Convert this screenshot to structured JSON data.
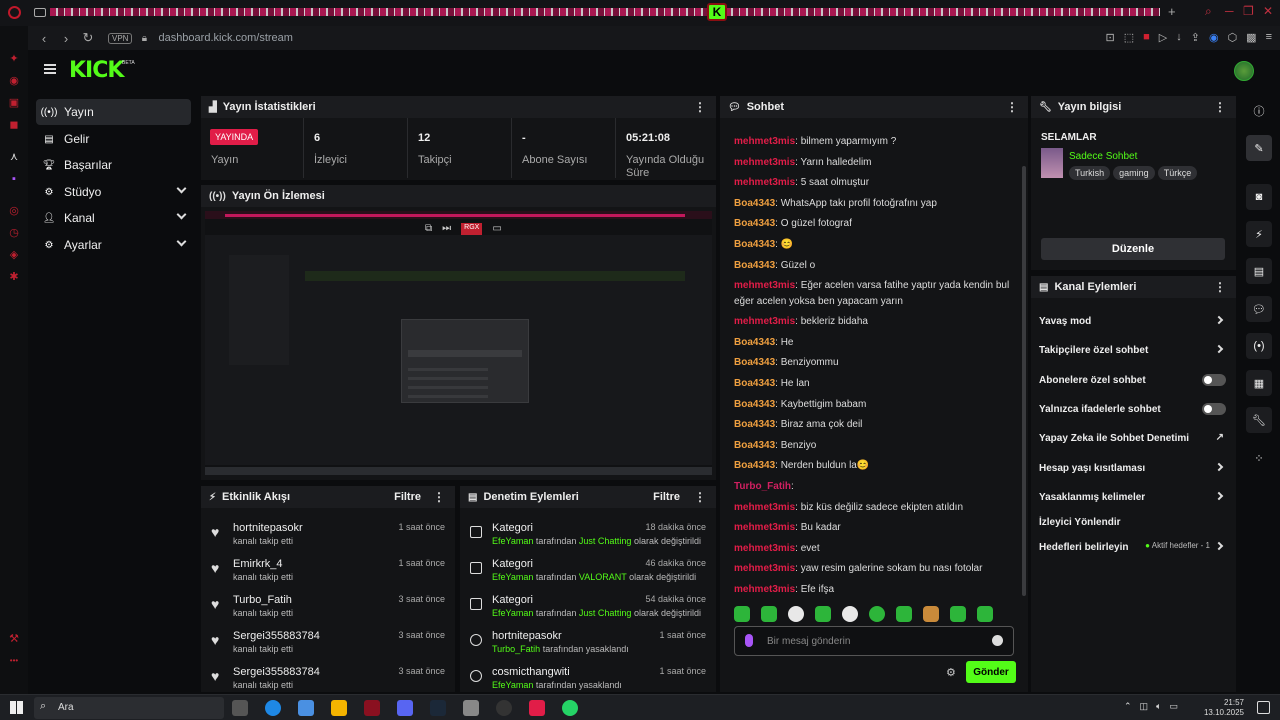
{
  "browser": {
    "url": "dashboard.kick.com/stream",
    "vpn_label": "VPN"
  },
  "header": {
    "logo": "KICK",
    "beta": "BETA"
  },
  "sidebar": {
    "items": [
      {
        "label": "Yayın",
        "icon": "broadcast-icon"
      },
      {
        "label": "Gelir",
        "icon": "wallet-icon"
      },
      {
        "label": "Başarılar",
        "icon": "trophy-icon"
      },
      {
        "label": "Stüdyo",
        "icon": "gear-icon"
      },
      {
        "label": "Kanal",
        "icon": "user-icon"
      },
      {
        "label": "Ayarlar",
        "icon": "gear-icon"
      }
    ]
  },
  "stats": {
    "title": "Yayın İstatistikleri",
    "live_badge": "YAYINDA",
    "live_label": "Yayın",
    "viewers_value": "6",
    "viewers_label": "İzleyici",
    "followers_value": "12",
    "followers_label": "Takipçi",
    "subs_value": "-",
    "subs_label": "Abone Sayısı",
    "uptime_value": "05:21:08",
    "uptime_label": "Yayında Olduğu Süre"
  },
  "preview": {
    "title": "Yayın Ön İzlemesi"
  },
  "activity": {
    "title": "Etkinlik Akışı",
    "filter": "Filtre",
    "items": [
      {
        "name": "hortnitepasokr",
        "sub": "kanalı takip etti",
        "time": "1 saat önce"
      },
      {
        "name": "Emirkrk_4",
        "sub": "kanalı takip etti",
        "time": "1 saat önce"
      },
      {
        "name": "Turbo_Fatih",
        "sub": "kanalı takip etti",
        "time": "3 saat önce"
      },
      {
        "name": "Sergei355883784",
        "sub": "kanalı takip etti",
        "time": "3 saat önce"
      },
      {
        "name": "Sergei355883784",
        "sub": "kanalı takip etti",
        "time": "3 saat önce"
      }
    ]
  },
  "moderation": {
    "title": "Denetim Eylemleri",
    "filter": "Filtre",
    "items": [
      {
        "title": "Kategori",
        "time": "18 dakika önce",
        "actor": "EfeYaman",
        "mid": " tarafından ",
        "target": "Just Chatting",
        "tail": " olarak değiştirildi"
      },
      {
        "title": "Kategori",
        "time": "46 dakika önce",
        "actor": "EfeYaman",
        "mid": " tarafından ",
        "target": "VALORANT",
        "tail": " olarak değiştirildi"
      },
      {
        "title": "Kategori",
        "time": "54 dakika önce",
        "actor": "EfeYaman",
        "mid": " tarafından ",
        "target": "Just Chatting",
        "tail": " olarak değiştirildi"
      },
      {
        "title": "hortnitepasokr",
        "time": "1 saat önce",
        "actor": "Turbo_Fatih",
        "mid": " tarafından yasaklandı",
        "target": "",
        "tail": ""
      },
      {
        "title": "cosmicthangwiti",
        "time": "1 saat önce",
        "actor": "EfeYaman",
        "mid": " tarafından yasaklandı",
        "target": "",
        "tail": ""
      }
    ]
  },
  "chat": {
    "title": "Sohbet",
    "messages": [
      {
        "user": "mehmet3mis",
        "text": "bilmem yaparmıyım ?",
        "cls": "u-mehmet"
      },
      {
        "user": "mehmet3mis",
        "text": "Yarın halledelim",
        "cls": "u-mehmet"
      },
      {
        "user": "mehmet3mis",
        "text": "5 saat olmuştur",
        "cls": "u-mehmet"
      },
      {
        "user": "Boa4343",
        "text": "WhatsApp takı profil fotoğrafını yap",
        "cls": "u-boa"
      },
      {
        "user": "Boa4343",
        "text": "O güzel fotograf",
        "cls": "u-boa"
      },
      {
        "user": "Boa4343",
        "text": "😊",
        "cls": "u-boa"
      },
      {
        "user": "Boa4343",
        "text": "Güzel o",
        "cls": "u-boa"
      },
      {
        "user": "mehmet3mis",
        "text": "Eğer acelen varsa fatihe yaptır yada kendin bul eğer acelen yoksa ben yapacam yarın",
        "cls": "u-mehmet"
      },
      {
        "user": "mehmet3mis",
        "text": "bekleriz bidaha",
        "cls": "u-mehmet"
      },
      {
        "user": "Boa4343",
        "text": "He",
        "cls": "u-boa"
      },
      {
        "user": "Boa4343",
        "text": "Benziyommu",
        "cls": "u-boa"
      },
      {
        "user": "Boa4343",
        "text": "He lan",
        "cls": "u-boa"
      },
      {
        "user": "Boa4343",
        "text": "Kaybettigim babam",
        "cls": "u-boa"
      },
      {
        "user": "Boa4343",
        "text": "Biraz ama çok deil",
        "cls": "u-boa"
      },
      {
        "user": "Boa4343",
        "text": "Benziyo",
        "cls": "u-boa"
      },
      {
        "user": "Boa4343",
        "text": "Nerden buldun la😊",
        "cls": "u-boa"
      },
      {
        "user": "Turbo_Fatih",
        "text": "",
        "cls": "u-turbo"
      },
      {
        "user": "mehmet3mis",
        "text": "biz küs değiliz sadece ekipten atıldın",
        "cls": "u-mehmet"
      },
      {
        "user": "mehmet3mis",
        "text": "Bu kadar",
        "cls": "u-mehmet"
      },
      {
        "user": "mehmet3mis",
        "text": "evet",
        "cls": "u-mehmet"
      },
      {
        "user": "mehmet3mis",
        "text": "yaw resim galerine sokam bu nası fotolar",
        "cls": "u-mehmet"
      },
      {
        "user": "mehmet3mis",
        "text": "Efe ifşa",
        "cls": "u-mehmet"
      }
    ],
    "input_placeholder": "Bir mesaj gönderin",
    "send_label": "Gönder"
  },
  "stream_info": {
    "title": "Yayın bilgisi",
    "stream_title": "SELAMLAR",
    "category": "Sadece Sohbet",
    "tags": [
      "Turkish",
      "gaming",
      "Türkçe"
    ],
    "edit_label": "Düzenle"
  },
  "channel_actions": {
    "title": "Kanal Eylemleri",
    "items": [
      {
        "label": "Yavaş mod",
        "kind": "chevron"
      },
      {
        "label": "Takipçilere özel sohbet",
        "kind": "chevron"
      },
      {
        "label": "Abonelere özel sohbet",
        "kind": "toggle"
      },
      {
        "label": "Yalnızca ifadelerle sohbet",
        "kind": "toggle"
      },
      {
        "label": "Yapay Zeka ile Sohbet Denetimi",
        "kind": "external"
      },
      {
        "label": "Hesap yaşı kısıtlaması",
        "kind": "chevron"
      },
      {
        "label": "Yasaklanmış kelimeler",
        "kind": "chevron"
      },
      {
        "label": "İzleyici Yönlendir",
        "kind": "none"
      },
      {
        "label": "Hedefleri belirleyin",
        "kind": "goals"
      }
    ],
    "goals_status": "Aktif hedefler - 1"
  },
  "taskbar": {
    "search": "Ara",
    "time": "21:57",
    "date": "13.10.2025"
  },
  "colors": {
    "brand": "#53fc18",
    "live": "#e11d48",
    "mod_user": "#e11d48",
    "viewer_user": "#f0a040"
  }
}
